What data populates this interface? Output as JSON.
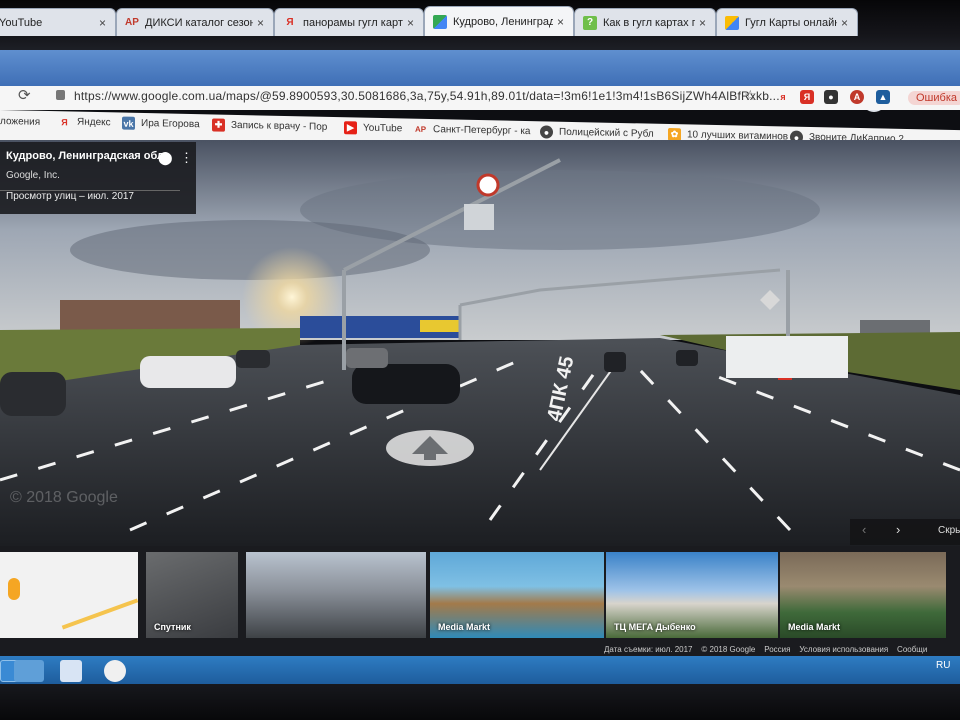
{
  "browser": {
    "tabs": [
      {
        "label": "YouTube",
        "favicon": "youtube-icon",
        "active": false
      },
      {
        "label": "ДИКСИ каталог сезон",
        "favicon": "ap-icon",
        "active": false
      },
      {
        "label": "панорамы гугл карты",
        "favicon": "yandex-icon",
        "active": false
      },
      {
        "label": "Кудрово, Ленинградск",
        "favicon": "google-maps-icon",
        "active": true
      },
      {
        "label": "Как в гугл картах посм",
        "favicon": "question-icon",
        "active": false
      },
      {
        "label": "Гугл Карты онлайн (Go",
        "favicon": "maps-icon",
        "active": false
      }
    ],
    "new_tab": "+",
    "reload": "⟳",
    "url": "https://www.google.com.ua/maps/@59.8900593,30.5081686,3a,75y,54.91h,89.01t/data=!3m6!1e1!3m4!1sB6SijZWh4AlBfRxkb...",
    "error_badge": "Ошибка",
    "bookmarks": [
      {
        "label": "ложения",
        "icon": "apps-icon"
      },
      {
        "label": "Яндекс",
        "icon": "yandex-icon"
      },
      {
        "label": "Ира Егорова",
        "icon": "vk-icon"
      },
      {
        "label": "Запись к врачу - Пор",
        "icon": "medical-icon"
      },
      {
        "label": "YouTube",
        "icon": "youtube-icon"
      },
      {
        "label": "Санкт-Петербург - ка",
        "icon": "ap-icon"
      },
      {
        "label": "Полицейский с Рубл",
        "icon": "spy-icon"
      },
      {
        "label": "10 лучших витаминов",
        "icon": "vitamin-icon"
      },
      {
        "label": "Звоните ДиКаприо 2",
        "icon": "spy-icon"
      }
    ]
  },
  "streetview": {
    "place": "Кудрово, Ленинградская обл.",
    "owner": "Google, Inc.",
    "date": "Просмотр улиц – июл. 2017",
    "road_number": "4ПК 45",
    "watermark": "© 2018 Google"
  },
  "filmstrip": {
    "thumbs": [
      {
        "caption": ""
      },
      {
        "caption": "Спутник"
      },
      {
        "caption": ""
      },
      {
        "caption": "Media Markt"
      },
      {
        "caption": "ТЦ МЕГА Дыбенко"
      },
      {
        "caption": "Media Markt"
      }
    ],
    "next_label": "Скры",
    "footer": [
      "Дата съемки: июл. 2017",
      "© 2018 Google",
      "Россия",
      "Условия использования",
      "Сообщи"
    ]
  },
  "taskbar": {
    "lang": "RU"
  },
  "colors": {
    "tabstrip": "#4a7bc0",
    "taskbar": "#2369ad",
    "accent_red": "#d93025"
  }
}
